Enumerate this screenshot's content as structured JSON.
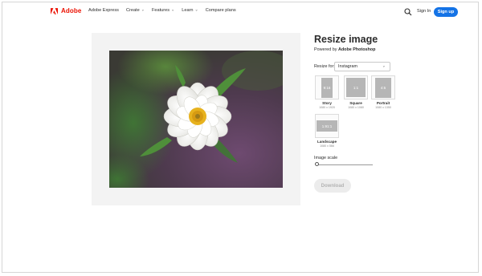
{
  "header": {
    "brand": "Adobe",
    "nav": [
      {
        "label": "Adobe Express",
        "dropdown": false
      },
      {
        "label": "Create",
        "dropdown": true
      },
      {
        "label": "Features",
        "dropdown": true
      },
      {
        "label": "Learn",
        "dropdown": true
      },
      {
        "label": "Compare plans",
        "dropdown": false
      }
    ],
    "sign_in": "Sign In",
    "sign_up": "Sign up"
  },
  "main": {
    "title": "Resize image",
    "powered_prefix": "Powered by ",
    "powered_brand": "Adobe Photoshop",
    "resize_for_label": "Resize for:",
    "resize_for_value": "Instagram",
    "options": [
      {
        "ratio": "9:16",
        "name": "Story",
        "size": "1080 x 1920"
      },
      {
        "ratio": "1:1",
        "name": "Square",
        "size": "1080 x 1080"
      },
      {
        "ratio": "4:5",
        "name": "Portrait",
        "size": "1080 x 1350"
      },
      {
        "ratio": "1.91:1",
        "name": "Landscape",
        "size": "1080 x 566"
      }
    ],
    "image_scale_label": "Image scale",
    "image_scale_value": 0,
    "download": "Download"
  },
  "colors": {
    "brand_red": "#eb1000",
    "accent_blue": "#1473e6"
  }
}
